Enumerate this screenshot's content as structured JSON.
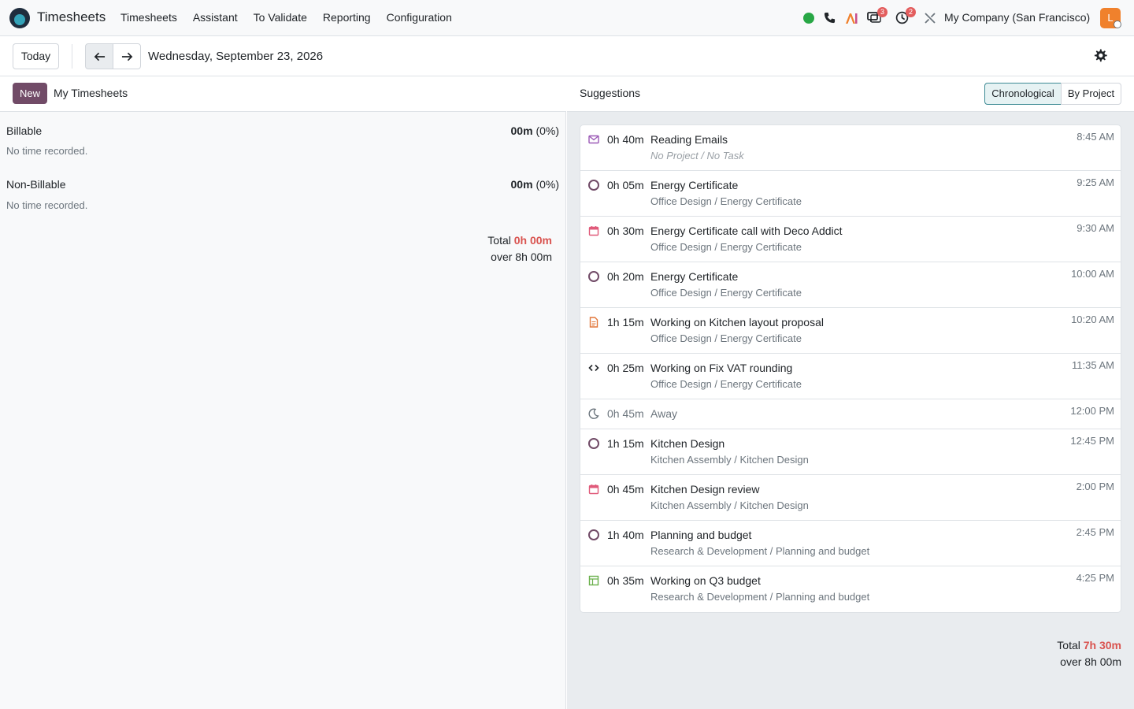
{
  "topbar": {
    "app_name": "Timesheets",
    "menu": [
      "Timesheets",
      "Assistant",
      "To Validate",
      "Reporting",
      "Configuration"
    ],
    "messages_badge": "3",
    "activities_badge": "2",
    "company": "My Company (San Francisco)",
    "avatar_letter": "L"
  },
  "controls": {
    "today_label": "Today",
    "date": "Wednesday, September 23, 2026"
  },
  "left": {
    "new_label": "New",
    "title": "My Timesheets",
    "billable_title": "Billable",
    "billable_value": "00m",
    "billable_pct": "(0%)",
    "billable_note": "No time recorded.",
    "nonbillable_title": "Non-Billable",
    "nonbillable_value": "00m",
    "nonbillable_pct": "(0%)",
    "nonbillable_note": "No time recorded.",
    "total_label": "Total",
    "total_value": "0h 00m",
    "over_label": "over 8h 00m"
  },
  "right": {
    "title": "Suggestions",
    "view_chronological": "Chronological",
    "view_by_project": "By Project",
    "items": [
      {
        "icon": "mail-icon",
        "duration": "0h 40m",
        "title": "Reading Emails",
        "subtitle": "No Project / No Task",
        "time": "8:45 AM"
      },
      {
        "icon": "task-circle-icon",
        "duration": "0h 05m",
        "title": "Energy Certificate",
        "subtitle": "Office Design / Energy Certificate",
        "time": "9:25 AM"
      },
      {
        "icon": "calendar-icon",
        "duration": "0h 30m",
        "title": "Energy Certificate call with Deco Addict",
        "subtitle": "Office Design / Energy Certificate",
        "time": "9:30 AM"
      },
      {
        "icon": "task-circle-icon",
        "duration": "0h 20m",
        "title": "Energy Certificate",
        "subtitle": "Office Design / Energy Certificate",
        "time": "10:00 AM"
      },
      {
        "icon": "document-icon",
        "duration": "1h 15m",
        "title": "Working on Kitchen layout proposal",
        "subtitle": "Office Design / Energy Certificate",
        "time": "10:20 AM"
      },
      {
        "icon": "code-icon",
        "duration": "0h 25m",
        "title": "Working on Fix VAT rounding",
        "subtitle": "Office Design / Energy Certificate",
        "time": "11:35 AM"
      },
      {
        "icon": "moon-icon",
        "duration": "0h 45m",
        "title": "Away",
        "subtitle": "",
        "time": "12:00 PM"
      },
      {
        "icon": "task-circle-icon",
        "duration": "1h 15m",
        "title": "Kitchen Design",
        "subtitle": "Kitchen Assembly / Kitchen Design",
        "time": "12:45 PM"
      },
      {
        "icon": "calendar-icon",
        "duration": "0h 45m",
        "title": "Kitchen Design review",
        "subtitle": "Kitchen Assembly / Kitchen Design",
        "time": "2:00 PM"
      },
      {
        "icon": "task-circle-icon",
        "duration": "1h 40m",
        "title": "Planning and budget",
        "subtitle": "Research & Development / Planning and budget",
        "time": "2:45 PM"
      },
      {
        "icon": "spreadsheet-icon",
        "duration": "0h 35m",
        "title": "Working on Q3 budget",
        "subtitle": "Research & Development / Planning and budget",
        "time": "4:25 PM"
      }
    ],
    "total_label": "Total",
    "total_value": "7h 30m",
    "over_label": "over 8h 00m"
  },
  "colors": {
    "brand": "#714b67",
    "accent": "#3c8a94",
    "danger": "#d9534f"
  }
}
